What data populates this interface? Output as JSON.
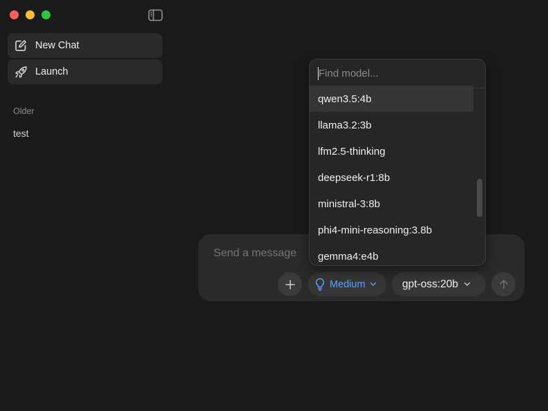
{
  "window": {
    "traffic_lights": [
      "close",
      "minimize",
      "maximize"
    ],
    "sidebar_toggle_icon": "sidebar-icon"
  },
  "sidebar": {
    "new_chat_label": "New Chat",
    "new_chat_icon": "compose-icon",
    "launch_label": "Launch",
    "launch_icon": "rocket-icon",
    "section_older": "Older",
    "history": [
      "test"
    ]
  },
  "composer": {
    "placeholder": "Send a message",
    "plus_icon": "plus-icon",
    "think_level": "Medium",
    "think_icon": "lightbulb-icon",
    "model": "gpt-oss:20b",
    "send_icon": "arrow-up-icon"
  },
  "model_dropdown": {
    "search_placeholder": "Find model...",
    "items": [
      "qwen3.5:4b",
      "llama3.2:3b",
      "lfm2.5-thinking",
      "deepseek-r1:8b",
      "ministral-3:8b",
      "phi4-mini-reasoning:3.8b",
      "gemma4:e4b"
    ],
    "highlighted_index": 0
  },
  "colors": {
    "background": "#1a1a1a",
    "panel": "#2a2a2a",
    "accent": "#5aa0ff",
    "close": "#ff5f57",
    "minimize": "#febc2e",
    "maximize": "#28c840"
  }
}
